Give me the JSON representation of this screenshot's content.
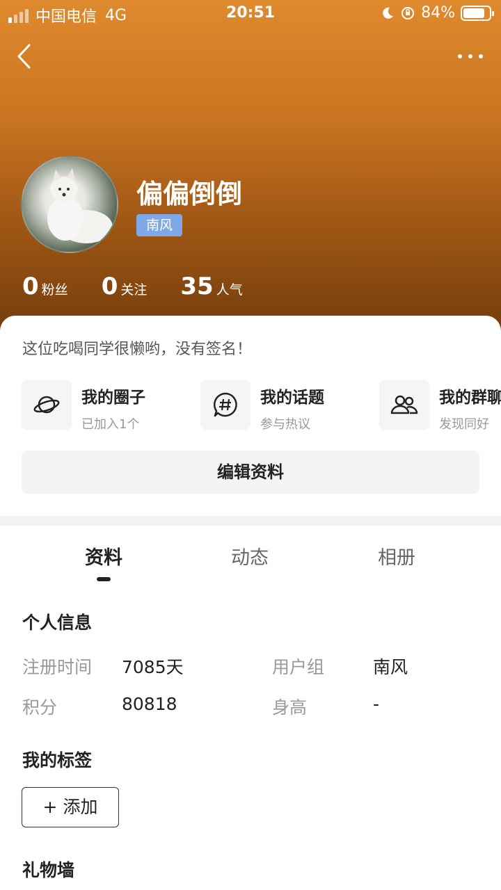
{
  "status_bar": {
    "carrier": "中国电信",
    "network": "4G",
    "time": "20:51",
    "battery_text": "84%",
    "battery_level": 0.84
  },
  "profile": {
    "name": "偏偏倒倒",
    "group_badge": "南风",
    "stats": [
      {
        "value": "0",
        "label": "粉丝"
      },
      {
        "value": "0",
        "label": "关注"
      },
      {
        "value": "35",
        "label": "人气"
      }
    ]
  },
  "signature": "这位吃喝同学很懒哟，没有签名！",
  "shortcuts": [
    {
      "title": "我的圈子",
      "subtitle": "已加入1个",
      "icon": "planet-icon"
    },
    {
      "title": "我的话题",
      "subtitle": "参与热议",
      "icon": "hashtag-bubble-icon"
    },
    {
      "title": "我的群聊",
      "subtitle": "发现同好",
      "icon": "group-people-icon"
    }
  ],
  "edit_button": "编辑资料",
  "tabs": [
    {
      "label": "资料",
      "active": true
    },
    {
      "label": "动态",
      "active": false
    },
    {
      "label": "相册",
      "active": false
    }
  ],
  "personal_info": {
    "title": "个人信息",
    "fields": [
      {
        "label": "注册时间",
        "value": "7085天"
      },
      {
        "label": "用户组",
        "value": "南风"
      },
      {
        "label": "积分",
        "value": "80818"
      },
      {
        "label": "身高",
        "value": "-"
      }
    ]
  },
  "tags": {
    "title": "我的标签",
    "add_label": "+ 添加"
  },
  "gift_wall": {
    "title": "礼物墙"
  },
  "colors": {
    "header_top": "#e08a2e",
    "header_bottom": "#6e3a0c",
    "badge": "#7fa8e8"
  }
}
